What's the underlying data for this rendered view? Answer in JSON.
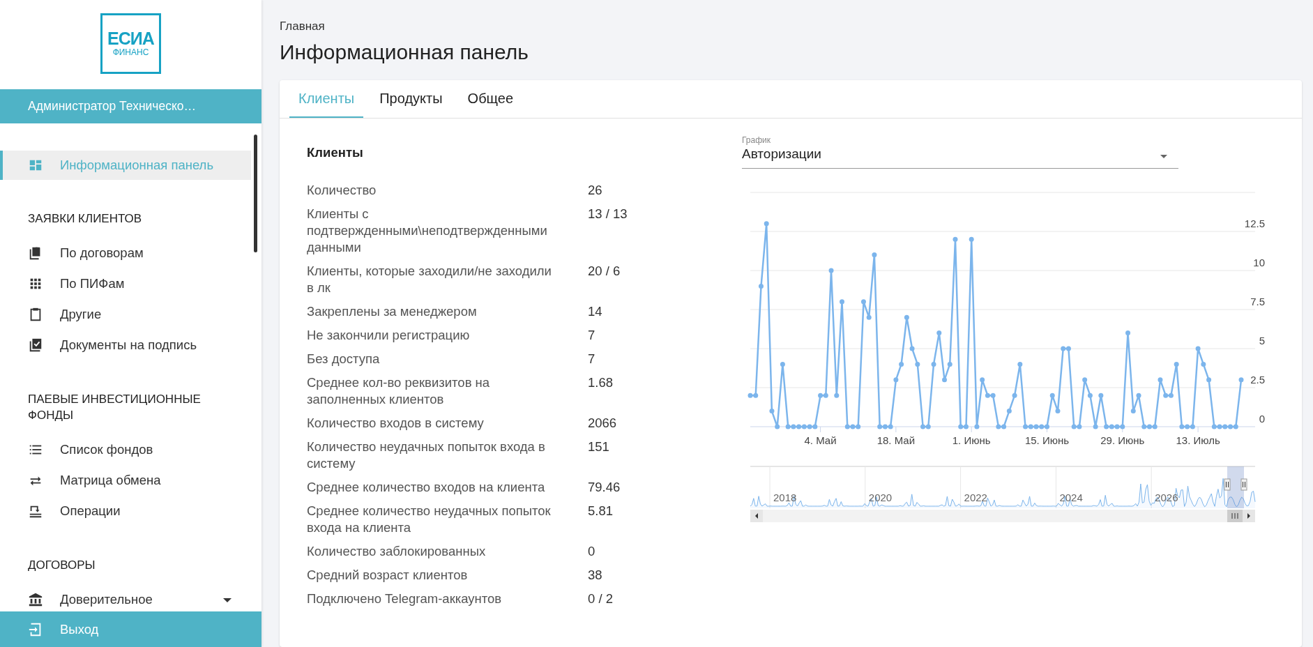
{
  "sidebar": {
    "logo": {
      "line_1": "ЕСИА",
      "line_2": "ФИНАНС"
    },
    "user": "Администратор Техническо…",
    "nav": [
      {
        "kind": "link",
        "label": "Информационная панель",
        "selected": true
      },
      {
        "kind": "section",
        "label": "ЗАЯВКИ КЛИЕНТОВ"
      },
      {
        "kind": "link",
        "label": "По договорам",
        "selected": false
      },
      {
        "kind": "link",
        "label": "По ПИФам",
        "selected": false
      },
      {
        "kind": "link",
        "label": "Другие",
        "selected": false
      },
      {
        "kind": "link",
        "label": "Документы на подпись",
        "selected": false
      },
      {
        "kind": "section",
        "label": "ПАЕВЫЕ ИНВЕСТИЦИОННЫЕ ФОНДЫ"
      },
      {
        "kind": "link",
        "label": "Список фондов",
        "selected": false
      },
      {
        "kind": "link",
        "label": "Матрица обмена",
        "selected": false
      },
      {
        "kind": "link",
        "label": "Операции",
        "selected": false
      },
      {
        "kind": "section",
        "label": "ДОГОВОРЫ"
      },
      {
        "kind": "link",
        "label": "Доверительное",
        "selected": false,
        "expandable": true
      }
    ],
    "logout": "Выход"
  },
  "breadcrumb": "Главная",
  "title": "Информационная панель",
  "tabs": [
    {
      "label": "Клиенты",
      "selected": true
    },
    {
      "label": "Продукты",
      "selected": false
    },
    {
      "label": "Общее",
      "selected": false
    }
  ],
  "stats": {
    "title": "Клиенты",
    "rows": [
      {
        "label": "Количество",
        "value": "26"
      },
      {
        "label": "Клиенты с подтвержденными\\неподтвержденными данными",
        "value": "13 / 13"
      },
      {
        "label": "Клиенты, которые заходили/не заходили в лк",
        "value": "20 / 6"
      },
      {
        "label": "Закреплены за менеджером",
        "value": "14"
      },
      {
        "label": "Не закончили регистрацию",
        "value": "7"
      },
      {
        "label": "Без доступа",
        "value": "7"
      },
      {
        "label": "Среднее кол-во реквизитов на заполненных клиентов",
        "value": "1.68"
      },
      {
        "label": "Количество входов в систему",
        "value": "2066"
      },
      {
        "label": "Количество неудачных попыток входа в систему",
        "value": "151"
      },
      {
        "label": "Среднее количество входов на клиента",
        "value": "79.46"
      },
      {
        "label": "Среднее количество неудачных попыток входа на клиента",
        "value": "5.81"
      },
      {
        "label": "Количество заблокированных",
        "value": "0"
      },
      {
        "label": "Средний возраст клиентов",
        "value": "38"
      },
      {
        "label": "Подключено Telegram-аккаунтов",
        "value": "0 / 2"
      }
    ]
  },
  "chart_panel": {
    "select": {
      "label": "График",
      "value": "Авторизации"
    },
    "chart_data": {
      "type": "line",
      "categories": [
        null,
        null,
        null,
        null,
        null,
        null,
        null,
        null,
        null,
        null,
        null,
        null,
        null,
        "4. Май",
        null,
        null,
        null,
        null,
        null,
        null,
        null,
        null,
        null,
        null,
        null,
        null,
        null,
        "18. Май",
        null,
        null,
        null,
        null,
        null,
        null,
        null,
        null,
        null,
        null,
        null,
        null,
        null,
        "1. Июнь",
        null,
        null,
        null,
        null,
        null,
        null,
        null,
        null,
        null,
        null,
        null,
        null,
        null,
        "15. Июнь",
        null,
        null,
        null,
        null,
        null,
        null,
        null,
        null,
        null,
        null,
        null,
        null,
        null,
        "29. Июнь",
        null,
        null,
        null,
        null,
        null,
        null,
        null,
        null,
        null,
        null,
        null,
        null,
        null,
        "13. Июль",
        null,
        null,
        null,
        null,
        null,
        null,
        null,
        null
      ],
      "grid": true,
      "series": [
        {
          "color": "#7cb5ec",
          "marker": true,
          "values": [
            2,
            2,
            9,
            13,
            1,
            0,
            4,
            0,
            0,
            0,
            0,
            0,
            0,
            2,
            2,
            10,
            2,
            8,
            0,
            0,
            0,
            8,
            7,
            11,
            0,
            0,
            0,
            3,
            4,
            7,
            5,
            4,
            0,
            0,
            4,
            6,
            3,
            4,
            12,
            0,
            0,
            12,
            0,
            3,
            2,
            2,
            0,
            0,
            1,
            2,
            4,
            0,
            0,
            0,
            0,
            0,
            2,
            1,
            5,
            5,
            0,
            0,
            3,
            2,
            0,
            2,
            0,
            0,
            0,
            0,
            6,
            1,
            2,
            0,
            0,
            0,
            3,
            2,
            2,
            4,
            0,
            0,
            0,
            5,
            4,
            3,
            0,
            0,
            0,
            0,
            0,
            3
          ]
        }
      ],
      "ylim": [
        0,
        15
      ],
      "yticks": [
        0,
        2.5,
        5,
        7.5,
        10,
        12.5
      ]
    },
    "navigator": {
      "labels": [
        "2018",
        "2020",
        "2022",
        "2024",
        "2026"
      ]
    }
  }
}
